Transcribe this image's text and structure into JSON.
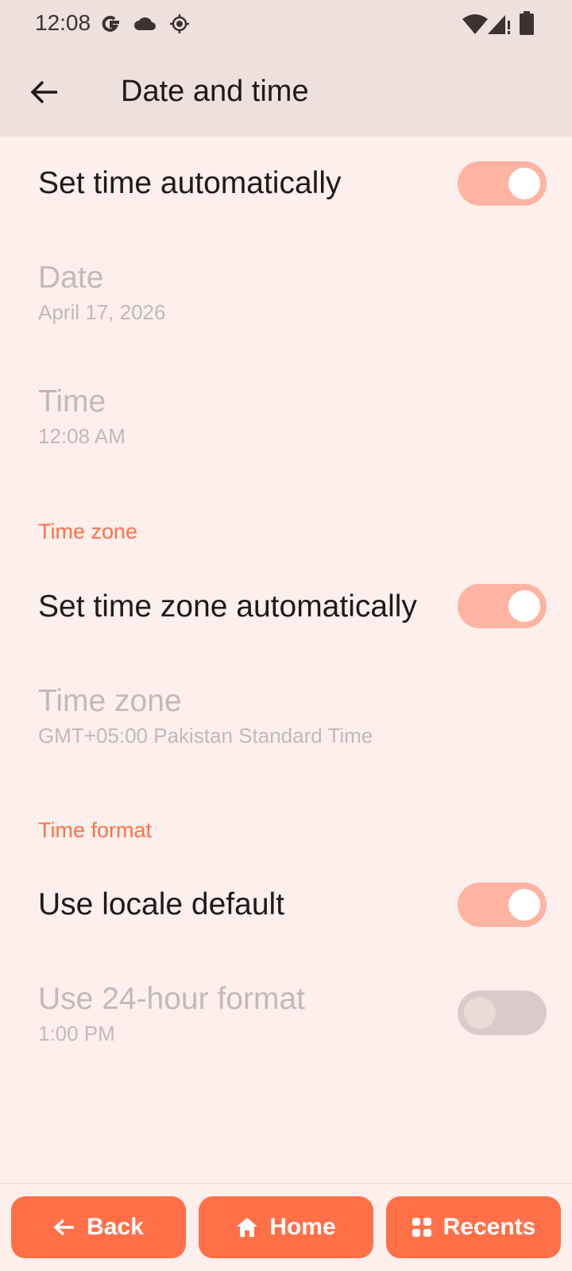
{
  "status_bar": {
    "time": "12:08",
    "icons": [
      "google-icon",
      "cloud-icon",
      "location-icon",
      "wifi-icon",
      "signal-icon",
      "battery-icon"
    ]
  },
  "app_bar": {
    "title": "Date and time",
    "back_icon": "arrow-back-icon"
  },
  "settings": {
    "set_time_auto": {
      "title": "Set time automatically",
      "enabled": true
    },
    "date": {
      "title": "Date",
      "value": "April 17, 2026"
    },
    "time": {
      "title": "Time",
      "value": "12:08 AM"
    },
    "time_zone_header": "Time zone",
    "set_tz_auto": {
      "title": "Set time zone automatically",
      "enabled": true
    },
    "time_zone": {
      "title": "Time zone",
      "value": "GMT+05:00 Pakistan Standard Time"
    },
    "time_format_header": "Time format",
    "locale_default": {
      "title": "Use locale default",
      "enabled": true
    },
    "use_24h": {
      "title": "Use 24-hour format",
      "value": "1:00 PM",
      "enabled": false
    }
  },
  "nav": {
    "back": "Back",
    "home": "Home",
    "recents": "Recents"
  },
  "colors": {
    "accent": "#ff7048",
    "toggle_on": "#ffb3a2",
    "background": "#fcefec",
    "bar": "#ede0dd"
  }
}
